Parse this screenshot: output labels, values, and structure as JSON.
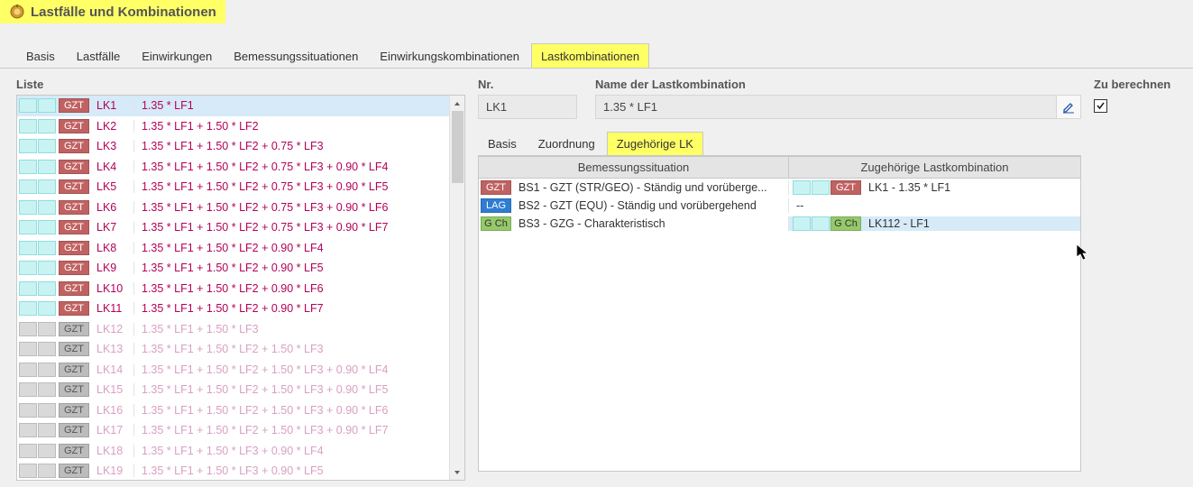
{
  "window": {
    "title": "Lastfälle und Kombinationen"
  },
  "mainTabs": [
    "Basis",
    "Lastfälle",
    "Einwirkungen",
    "Bemessungssituationen",
    "Einwirkungskombinationen",
    "Lastkombinationen"
  ],
  "mainTabActive": 5,
  "left": {
    "header": "Liste",
    "items": [
      {
        "sw": "cyan",
        "badge": "gzt",
        "badgeText": "GZT",
        "id": "LK1",
        "desc": "1.35 * LF1",
        "dim": false,
        "sel": true
      },
      {
        "sw": "cyan",
        "badge": "gzt",
        "badgeText": "GZT",
        "id": "LK2",
        "desc": "1.35 * LF1 + 1.50 * LF2",
        "dim": false
      },
      {
        "sw": "cyan",
        "badge": "gzt",
        "badgeText": "GZT",
        "id": "LK3",
        "desc": "1.35 * LF1 + 1.50 * LF2 + 0.75 * LF3",
        "dim": false
      },
      {
        "sw": "cyan",
        "badge": "gzt",
        "badgeText": "GZT",
        "id": "LK4",
        "desc": "1.35 * LF1 + 1.50 * LF2 + 0.75 * LF3 + 0.90 * LF4",
        "dim": false
      },
      {
        "sw": "cyan",
        "badge": "gzt",
        "badgeText": "GZT",
        "id": "LK5",
        "desc": "1.35 * LF1 + 1.50 * LF2 + 0.75 * LF3 + 0.90 * LF5",
        "dim": false
      },
      {
        "sw": "cyan",
        "badge": "gzt",
        "badgeText": "GZT",
        "id": "LK6",
        "desc": "1.35 * LF1 + 1.50 * LF2 + 0.75 * LF3 + 0.90 * LF6",
        "dim": false
      },
      {
        "sw": "cyan",
        "badge": "gzt",
        "badgeText": "GZT",
        "id": "LK7",
        "desc": "1.35 * LF1 + 1.50 * LF2 + 0.75 * LF3 + 0.90 * LF7",
        "dim": false
      },
      {
        "sw": "cyan",
        "badge": "gzt",
        "badgeText": "GZT",
        "id": "LK8",
        "desc": "1.35 * LF1 + 1.50 * LF2 + 0.90 * LF4",
        "dim": false
      },
      {
        "sw": "cyan",
        "badge": "gzt",
        "badgeText": "GZT",
        "id": "LK9",
        "desc": "1.35 * LF1 + 1.50 * LF2 + 0.90 * LF5",
        "dim": false
      },
      {
        "sw": "cyan",
        "badge": "gzt",
        "badgeText": "GZT",
        "id": "LK10",
        "desc": "1.35 * LF1 + 1.50 * LF2 + 0.90 * LF6",
        "dim": false
      },
      {
        "sw": "cyan",
        "badge": "gzt",
        "badgeText": "GZT",
        "id": "LK11",
        "desc": "1.35 * LF1 + 1.50 * LF2 + 0.90 * LF7",
        "dim": false
      },
      {
        "sw": "gray",
        "badge": "gray",
        "badgeText": "GZT",
        "id": "LK12",
        "desc": "1.35 * LF1 + 1.50 * LF3",
        "dim": true
      },
      {
        "sw": "gray",
        "badge": "gray",
        "badgeText": "GZT",
        "id": "LK13",
        "desc": "1.35 * LF1 + 1.50 * LF2 + 1.50 * LF3",
        "dim": true
      },
      {
        "sw": "gray",
        "badge": "gray",
        "badgeText": "GZT",
        "id": "LK14",
        "desc": "1.35 * LF1 + 1.50 * LF2 + 1.50 * LF3 + 0.90 * LF4",
        "dim": true
      },
      {
        "sw": "gray",
        "badge": "gray",
        "badgeText": "GZT",
        "id": "LK15",
        "desc": "1.35 * LF1 + 1.50 * LF2 + 1.50 * LF3 + 0.90 * LF5",
        "dim": true
      },
      {
        "sw": "gray",
        "badge": "gray",
        "badgeText": "GZT",
        "id": "LK16",
        "desc": "1.35 * LF1 + 1.50 * LF2 + 1.50 * LF3 + 0.90 * LF6",
        "dim": true
      },
      {
        "sw": "gray",
        "badge": "gray",
        "badgeText": "GZT",
        "id": "LK17",
        "desc": "1.35 * LF1 + 1.50 * LF2 + 1.50 * LF3 + 0.90 * LF7",
        "dim": true
      },
      {
        "sw": "gray",
        "badge": "gray",
        "badgeText": "GZT",
        "id": "LK18",
        "desc": "1.35 * LF1 + 1.50 * LF3 + 0.90 * LF4",
        "dim": true
      },
      {
        "sw": "gray",
        "badge": "gray",
        "badgeText": "GZT",
        "id": "LK19",
        "desc": "1.35 * LF1 + 1.50 * LF3 + 0.90 * LF5",
        "dim": true
      }
    ]
  },
  "right": {
    "nrLabel": "Nr.",
    "nrValue": "LK1",
    "nameLabel": "Name der Lastkombination",
    "nameValue": "1.35 * LF1",
    "computeLabel": "Zu berechnen",
    "computeChecked": true,
    "subTabs": [
      "Basis",
      "Zuordnung",
      "Zugehörige LK"
    ],
    "subTabActive": 2,
    "assign": {
      "headLeft": "Bemessungssituation",
      "headRight": "Zugehörige Lastkombination",
      "rows": [
        {
          "lBadge": "gzt",
          "lBadgeText": "GZT",
          "lText": "BS1 - GZT (STR/GEO) - Ständig und vorüberge...",
          "rSw": "cyan",
          "rBadge": "gzt",
          "rBadgeText": "GZT",
          "rText": "LK1 - 1.35 * LF1",
          "sel": false
        },
        {
          "lBadge": "lag",
          "lBadgeText": "LAG",
          "lText": "BS2 - GZT (EQU) - Ständig und vorübergehend",
          "rSw": null,
          "rBadge": null,
          "rBadgeText": "",
          "rText": "--",
          "sel": false
        },
        {
          "lBadge": "gch",
          "lBadgeText": "G Ch",
          "lText": "BS3 - GZG - Charakteristisch",
          "rSw": "cyan",
          "rBadge": "gch",
          "rBadgeText": "G Ch",
          "rText": "LK112 - LF1",
          "sel": true
        }
      ]
    }
  }
}
